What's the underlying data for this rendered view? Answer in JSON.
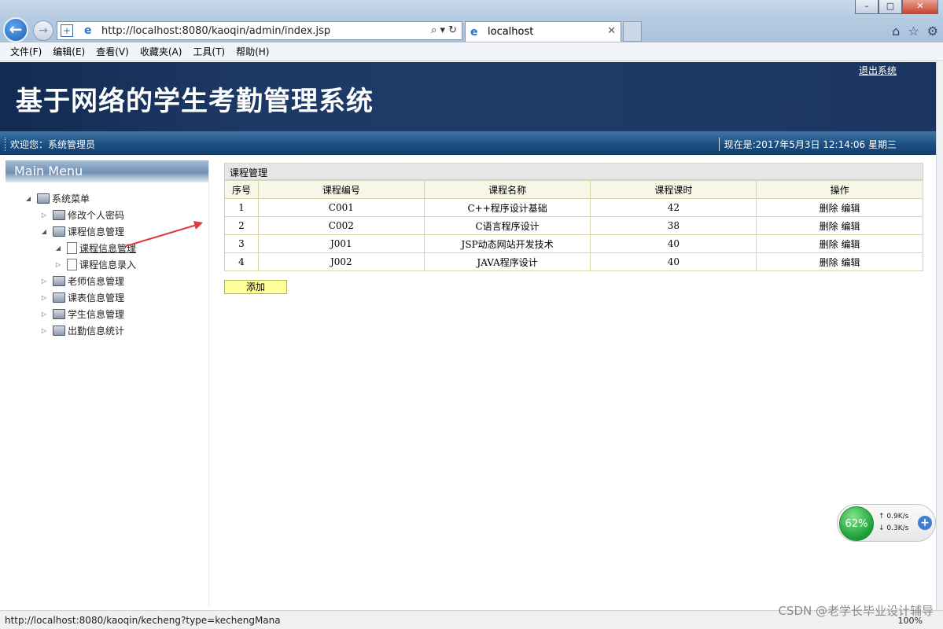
{
  "browser": {
    "url": "http://localhost:8080/kaoqin/admin/index.jsp",
    "tab_title": "localhost",
    "menu": [
      "文件(F)",
      "编辑(E)",
      "查看(V)",
      "收藏夹(A)",
      "工具(T)",
      "帮助(H)"
    ],
    "status_url": "http://localhost:8080/kaoqin/kecheng?type=kechengMana",
    "zoom": "100%"
  },
  "header": {
    "system_title": "基于网络的学生考勤管理系统",
    "logout": "退出系统",
    "welcome": "欢迎您：系统管理员",
    "now": "现在是:2017年5月3日 12:14:06 星期三"
  },
  "sidebar": {
    "title": "Main Menu",
    "root": "系统菜单",
    "items": [
      {
        "label": "修改个人密码"
      },
      {
        "label": "课程信息管理",
        "children": [
          {
            "label": "课程信息管理"
          },
          {
            "label": "课程信息录入"
          }
        ]
      },
      {
        "label": "老师信息管理"
      },
      {
        "label": "课表信息管理"
      },
      {
        "label": "学生信息管理"
      },
      {
        "label": "出勤信息统计"
      }
    ]
  },
  "main": {
    "panel_title": "课程管理",
    "columns": [
      "序号",
      "课程编号",
      "课程名称",
      "课程课时",
      "操作"
    ],
    "rows": [
      {
        "no": "1",
        "code": "C001",
        "name": "C++程序设计基础",
        "hours": "42",
        "del": "删除",
        "edit": "编辑"
      },
      {
        "no": "2",
        "code": "C002",
        "name": "C语言程序设计",
        "hours": "38",
        "del": "删除",
        "edit": "编辑"
      },
      {
        "no": "3",
        "code": "J001",
        "name": "JSP动态网站开发技术",
        "hours": "40",
        "del": "删除",
        "edit": "编辑"
      },
      {
        "no": "4",
        "code": "J002",
        "name": "JAVA程序设计",
        "hours": "40",
        "del": "删除",
        "edit": "编辑"
      }
    ],
    "add_label": "添加"
  },
  "net_widget": {
    "percent": "62%",
    "up": "0.9K/s",
    "down": "0.3K/s"
  },
  "watermark": "CSDN @老学长毕业设计辅导",
  "colors": {
    "banner": "#1d3a66",
    "infobar": "#1c4f82",
    "add_button": "#ffff99",
    "arrow": "#e03a3a"
  }
}
